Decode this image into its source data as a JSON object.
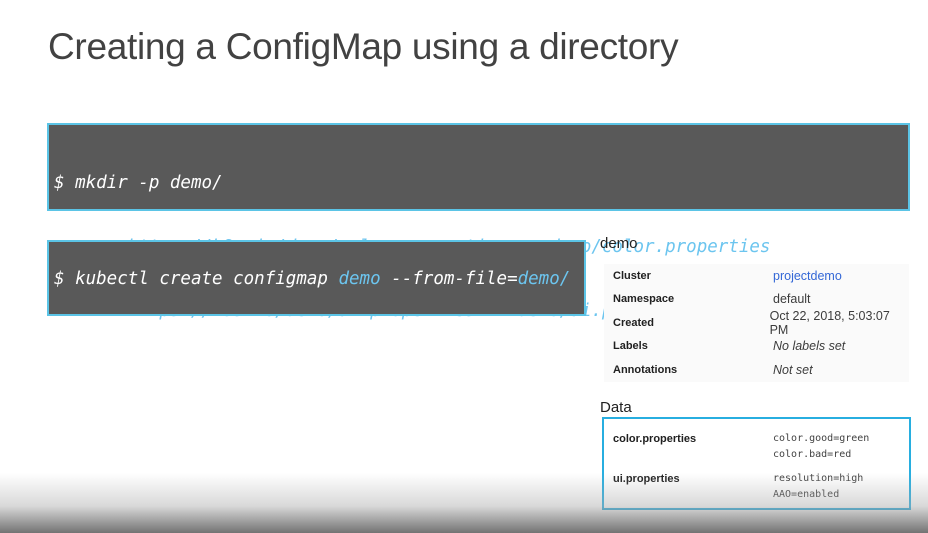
{
  "slide": {
    "title": "Creating a ConfigMap using a directory"
  },
  "code_block_1": {
    "lines": [
      [
        {
          "t": "$ mkdir -p demo/",
          "c": "plain"
        }
      ],
      [
        {
          "t": "$ wget ",
          "c": "plain"
        },
        {
          "t": "https://k8s.io/demo/color.properties",
          "c": "url"
        },
        {
          "t": " -O ",
          "c": "plain"
        },
        {
          "t": "demo/color.properties",
          "c": "url"
        }
      ],
      [
        {
          "t": "$ wget ",
          "c": "plain"
        },
        {
          "t": "https://k8s.io/demo/ui.properties",
          "c": "url"
        },
        {
          "t": " -O ",
          "c": "plain"
        },
        {
          "t": "demo/ui.properties",
          "c": "url"
        }
      ]
    ]
  },
  "code_block_2": {
    "parts": [
      {
        "t": "$ kubectl create configmap ",
        "c": "plain"
      },
      {
        "t": "demo",
        "c": "url"
      },
      {
        "t": " --from-file=",
        "c": "plain"
      },
      {
        "t": "demo/",
        "c": "url"
      }
    ]
  },
  "panel": {
    "title": "demo",
    "rows": [
      {
        "key": "Cluster",
        "value": "projectdemo",
        "style": "link"
      },
      {
        "key": "Namespace",
        "value": "default",
        "style": "plain"
      },
      {
        "key": "Created",
        "value": "Oct 22, 2018, 5:03:07 PM",
        "style": "plain"
      },
      {
        "key": "Labels",
        "value": "No labels set",
        "style": "ital"
      },
      {
        "key": "Annotations",
        "value": "Not set",
        "style": "ital"
      }
    ]
  },
  "data": {
    "title": "Data",
    "items": [
      {
        "key": "color.properties",
        "value_lines": [
          "color.good=green",
          "color.bad=red"
        ]
      },
      {
        "key": "ui.properties",
        "value_lines": [
          "resolution=high",
          "AAO=enabled"
        ]
      }
    ]
  },
  "colors": {
    "code_bg": "#595959",
    "code_border": "#5bc4e6",
    "url_text": "#6cc5ef",
    "link": "#3367d6",
    "data_border": "#27aee0"
  }
}
